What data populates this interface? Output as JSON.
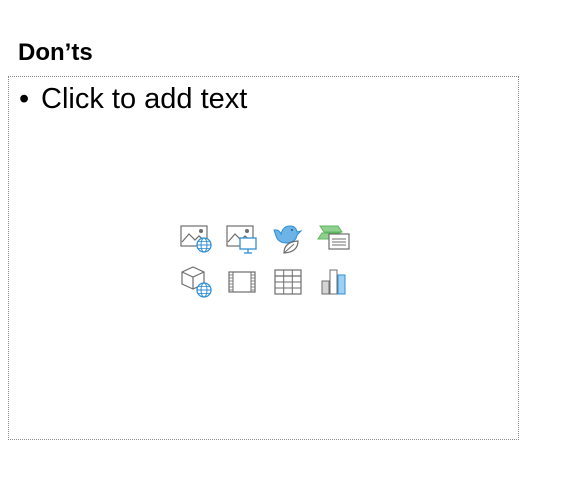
{
  "slide": {
    "title": "Don’ts",
    "content_placeholder": {
      "bullet": "•",
      "prompt": "Click to add text"
    },
    "insert_icons": [
      {
        "name": "online-pictures-icon"
      },
      {
        "name": "pictures-icon"
      },
      {
        "name": "icons-icon"
      },
      {
        "name": "smartart-icon"
      },
      {
        "name": "3d-models-icon"
      },
      {
        "name": "video-icon"
      },
      {
        "name": "table-icon"
      },
      {
        "name": "chart-icon"
      }
    ],
    "colors": {
      "accent_blue": "#2f8fd6",
      "accent_green": "#5cb85c",
      "icon_gray": "#6d6d6d",
      "border": "#8a8a8a"
    }
  }
}
